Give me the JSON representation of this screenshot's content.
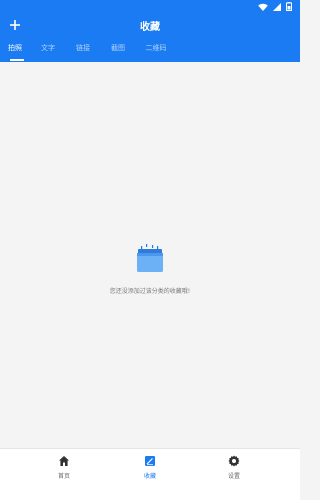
{
  "app_bar": {
    "title": "收藏",
    "add_icon": "plus-icon"
  },
  "tabs": [
    {
      "label": "拍照",
      "active": true
    },
    {
      "label": "文字",
      "active": false
    },
    {
      "label": "链接",
      "active": false
    },
    {
      "label": "截图",
      "active": false
    },
    {
      "label": "二维码",
      "active": false
    }
  ],
  "empty_state": {
    "icon": "folder-icon",
    "message": "您还没添加过该分类的收藏哦!"
  },
  "bottom_nav": [
    {
      "label": "首页",
      "icon": "home-icon",
      "active": false
    },
    {
      "label": "收藏",
      "icon": "bookmark-icon",
      "active": true
    },
    {
      "label": "设置",
      "icon": "gear-icon",
      "active": false
    }
  ],
  "colors": {
    "primary": "#1a7bf2",
    "background": "#f4f4f4",
    "active_nav": "#1a7bf2"
  }
}
